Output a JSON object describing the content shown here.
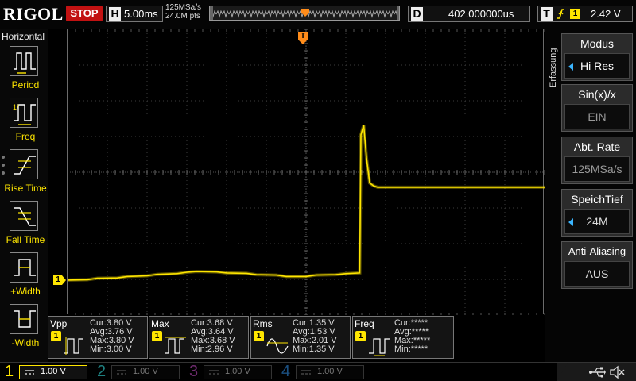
{
  "brand": "RIGOL",
  "run_state": "STOP",
  "timebase": {
    "letter": "H",
    "value": "5.00ms"
  },
  "sample_rate": "125MSa/s",
  "memory_points": "24.0M pts",
  "delay": {
    "letter": "D",
    "value": "402.000000us"
  },
  "trigger": {
    "letter": "T",
    "source": "1",
    "level": "2.42 V"
  },
  "left_panel": {
    "title": "Horizontal",
    "items": [
      {
        "label": "Period",
        "icon": "period-icon"
      },
      {
        "label": "Freq",
        "icon": "freq-icon"
      },
      {
        "label": "Rise Time",
        "icon": "rise-time-icon"
      },
      {
        "label": "Fall Time",
        "icon": "fall-time-icon"
      },
      {
        "label": "+Width",
        "icon": "positive-width-icon"
      },
      {
        "label": "-Width",
        "icon": "negative-width-icon"
      }
    ]
  },
  "right_panel": {
    "title": "Erfassung",
    "items": [
      {
        "label": "Modus",
        "value": "Hi Res"
      },
      {
        "label": "Sin(x)/x",
        "value": "EIN"
      },
      {
        "label": "Abt. Rate",
        "value": "125MSa/s"
      },
      {
        "label": "SpeichTief",
        "value": "24M"
      },
      {
        "label": "Anti-Aliasing",
        "value": "AUS"
      }
    ]
  },
  "markers": {
    "trigger_top": "T",
    "trigger_right": "T",
    "channel_ground": "1"
  },
  "measurements": [
    {
      "name": "Vpp",
      "badge": "1",
      "cur": "Cur:3.80 V",
      "avg": "Avg:3.76 V",
      "max": "Max:3.80 V",
      "min": "Min:3.00 V"
    },
    {
      "name": "Max",
      "badge": "1",
      "cur": "Cur:3.68 V",
      "avg": "Avg:3.64 V",
      "max": "Max:3.68 V",
      "min": "Min:2.96 V"
    },
    {
      "name": "Rms",
      "badge": "1",
      "cur": "Cur:1.35 V",
      "avg": "Avg:1.53 V",
      "max": "Max:2.01 V",
      "min": "Min:1.35 V"
    },
    {
      "name": "Freq",
      "badge": "1",
      "cur": "Cur:*****",
      "avg": "Avg:*****",
      "max": "Max:*****",
      "min": "Min:*****"
    }
  ],
  "channels": [
    {
      "num": "1",
      "scale": "1.00 V",
      "color": "#ffe600",
      "active": true
    },
    {
      "num": "2",
      "scale": "1.00 V",
      "color": "#1e8080",
      "active": false
    },
    {
      "num": "3",
      "scale": "1.00 V",
      "color": "#6e2a6e",
      "active": false
    },
    {
      "num": "4",
      "scale": "1.00 V",
      "color": "#1a4f80",
      "active": false
    }
  ],
  "status_icons": [
    "usb-icon",
    "speaker-muted-icon"
  ],
  "colors": {
    "trace": "#ffe600",
    "stop": "#c21212",
    "trigger_marker": "#ff8c1a",
    "menu_arrow": "#3bb6ff"
  },
  "waveform": {
    "unit": "div",
    "points": [
      [
        0.0,
        -3.02
      ],
      [
        0.5,
        -3.01
      ],
      [
        0.75,
        -2.97
      ],
      [
        1.25,
        -2.96
      ],
      [
        1.5,
        -2.92
      ],
      [
        2.0,
        -2.9
      ],
      [
        2.25,
        -2.86
      ],
      [
        2.75,
        -2.84
      ],
      [
        3.0,
        -2.8
      ],
      [
        3.25,
        -2.78
      ],
      [
        3.75,
        -2.79
      ],
      [
        4.0,
        -2.82
      ],
      [
        4.5,
        -2.83
      ],
      [
        4.75,
        -2.87
      ],
      [
        5.25,
        -2.88
      ],
      [
        5.5,
        -2.92
      ],
      [
        6.0,
        -2.92
      ],
      [
        6.25,
        -2.88
      ],
      [
        6.75,
        -2.87
      ],
      [
        7.0,
        -2.84
      ],
      [
        7.35,
        -2.82
      ],
      [
        7.38,
        1.05
      ],
      [
        7.45,
        1.32
      ],
      [
        7.52,
        0.4
      ],
      [
        7.6,
        -0.3
      ],
      [
        7.7,
        -0.38
      ],
      [
        7.8,
        -0.42
      ],
      [
        9.0,
        -0.42
      ],
      [
        12.0,
        -0.42
      ]
    ]
  }
}
